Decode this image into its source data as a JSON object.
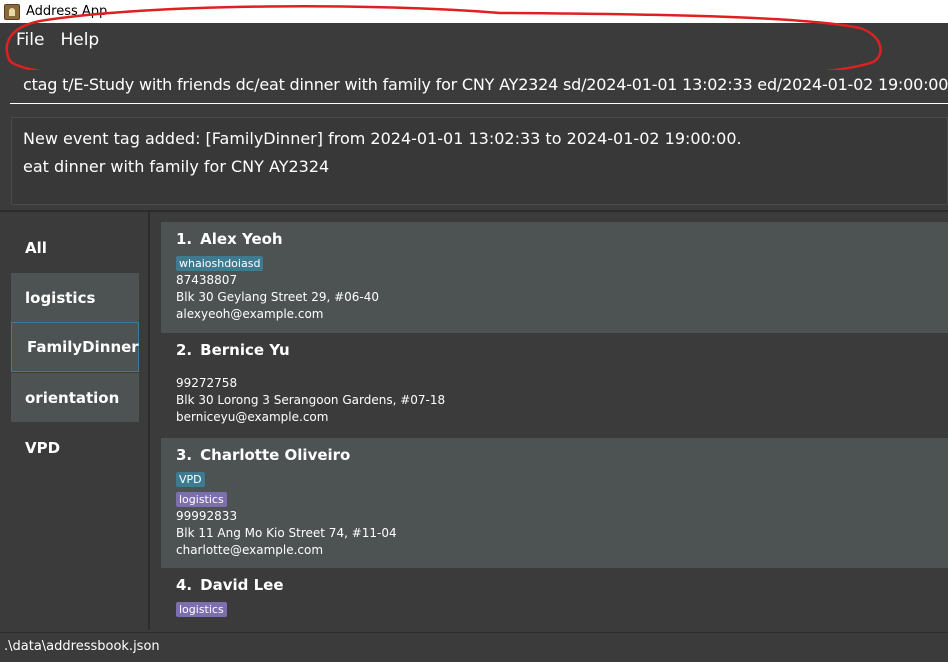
{
  "window": {
    "title": "Address App"
  },
  "menu": {
    "file": "File",
    "help": "Help"
  },
  "command": {
    "value": "ctag t/E-Study with friends dc/eat dinner with family for CNY AY2324 sd/2024-01-01 13:02:33 ed/2024-01-02 19:00:00",
    "annotation_color": "#e02020"
  },
  "result": {
    "line1": "New event tag added: [FamilyDinner] from 2024-01-01 13:02:33 to 2024-01-02 19:00:00.",
    "line2": "eat dinner with family for CNY AY2324"
  },
  "sidebar": {
    "items": [
      {
        "label": "All"
      },
      {
        "label": "logistics"
      },
      {
        "label": "FamilyDinner"
      },
      {
        "label": "orientation"
      },
      {
        "label": "VPD"
      }
    ],
    "selected": "FamilyDinner"
  },
  "persons": [
    {
      "index": "1.",
      "name": "Alex Yeoh",
      "tags": [
        "whaioshdoiasd"
      ],
      "phone": "87438807",
      "address": "Blk 30 Geylang Street 29, #06-40",
      "email": "alexyeoh@example.com"
    },
    {
      "index": "2.",
      "name": "Bernice Yu",
      "tags": [],
      "phone": "99272758",
      "address": "Blk 30 Lorong 3 Serangoon Gardens, #07-18",
      "email": "berniceyu@example.com"
    },
    {
      "index": "3.",
      "name": "Charlotte Oliveiro",
      "tags": [
        "VPD",
        "logistics"
      ],
      "phone": "99992833",
      "address": "Blk 11 Ang Mo Kio Street 74, #11-04",
      "email": "charlotte@example.com"
    },
    {
      "index": "4.",
      "name": "David Lee",
      "tags": [
        "logistics"
      ]
    }
  ],
  "status": {
    "path": ".\\data\\addressbook.json"
  },
  "colors": {
    "tag_blue": "#3e7b91",
    "tag_purple": "#7d6fae",
    "background": "#3b3b3b",
    "accent": "#3c7d96"
  }
}
